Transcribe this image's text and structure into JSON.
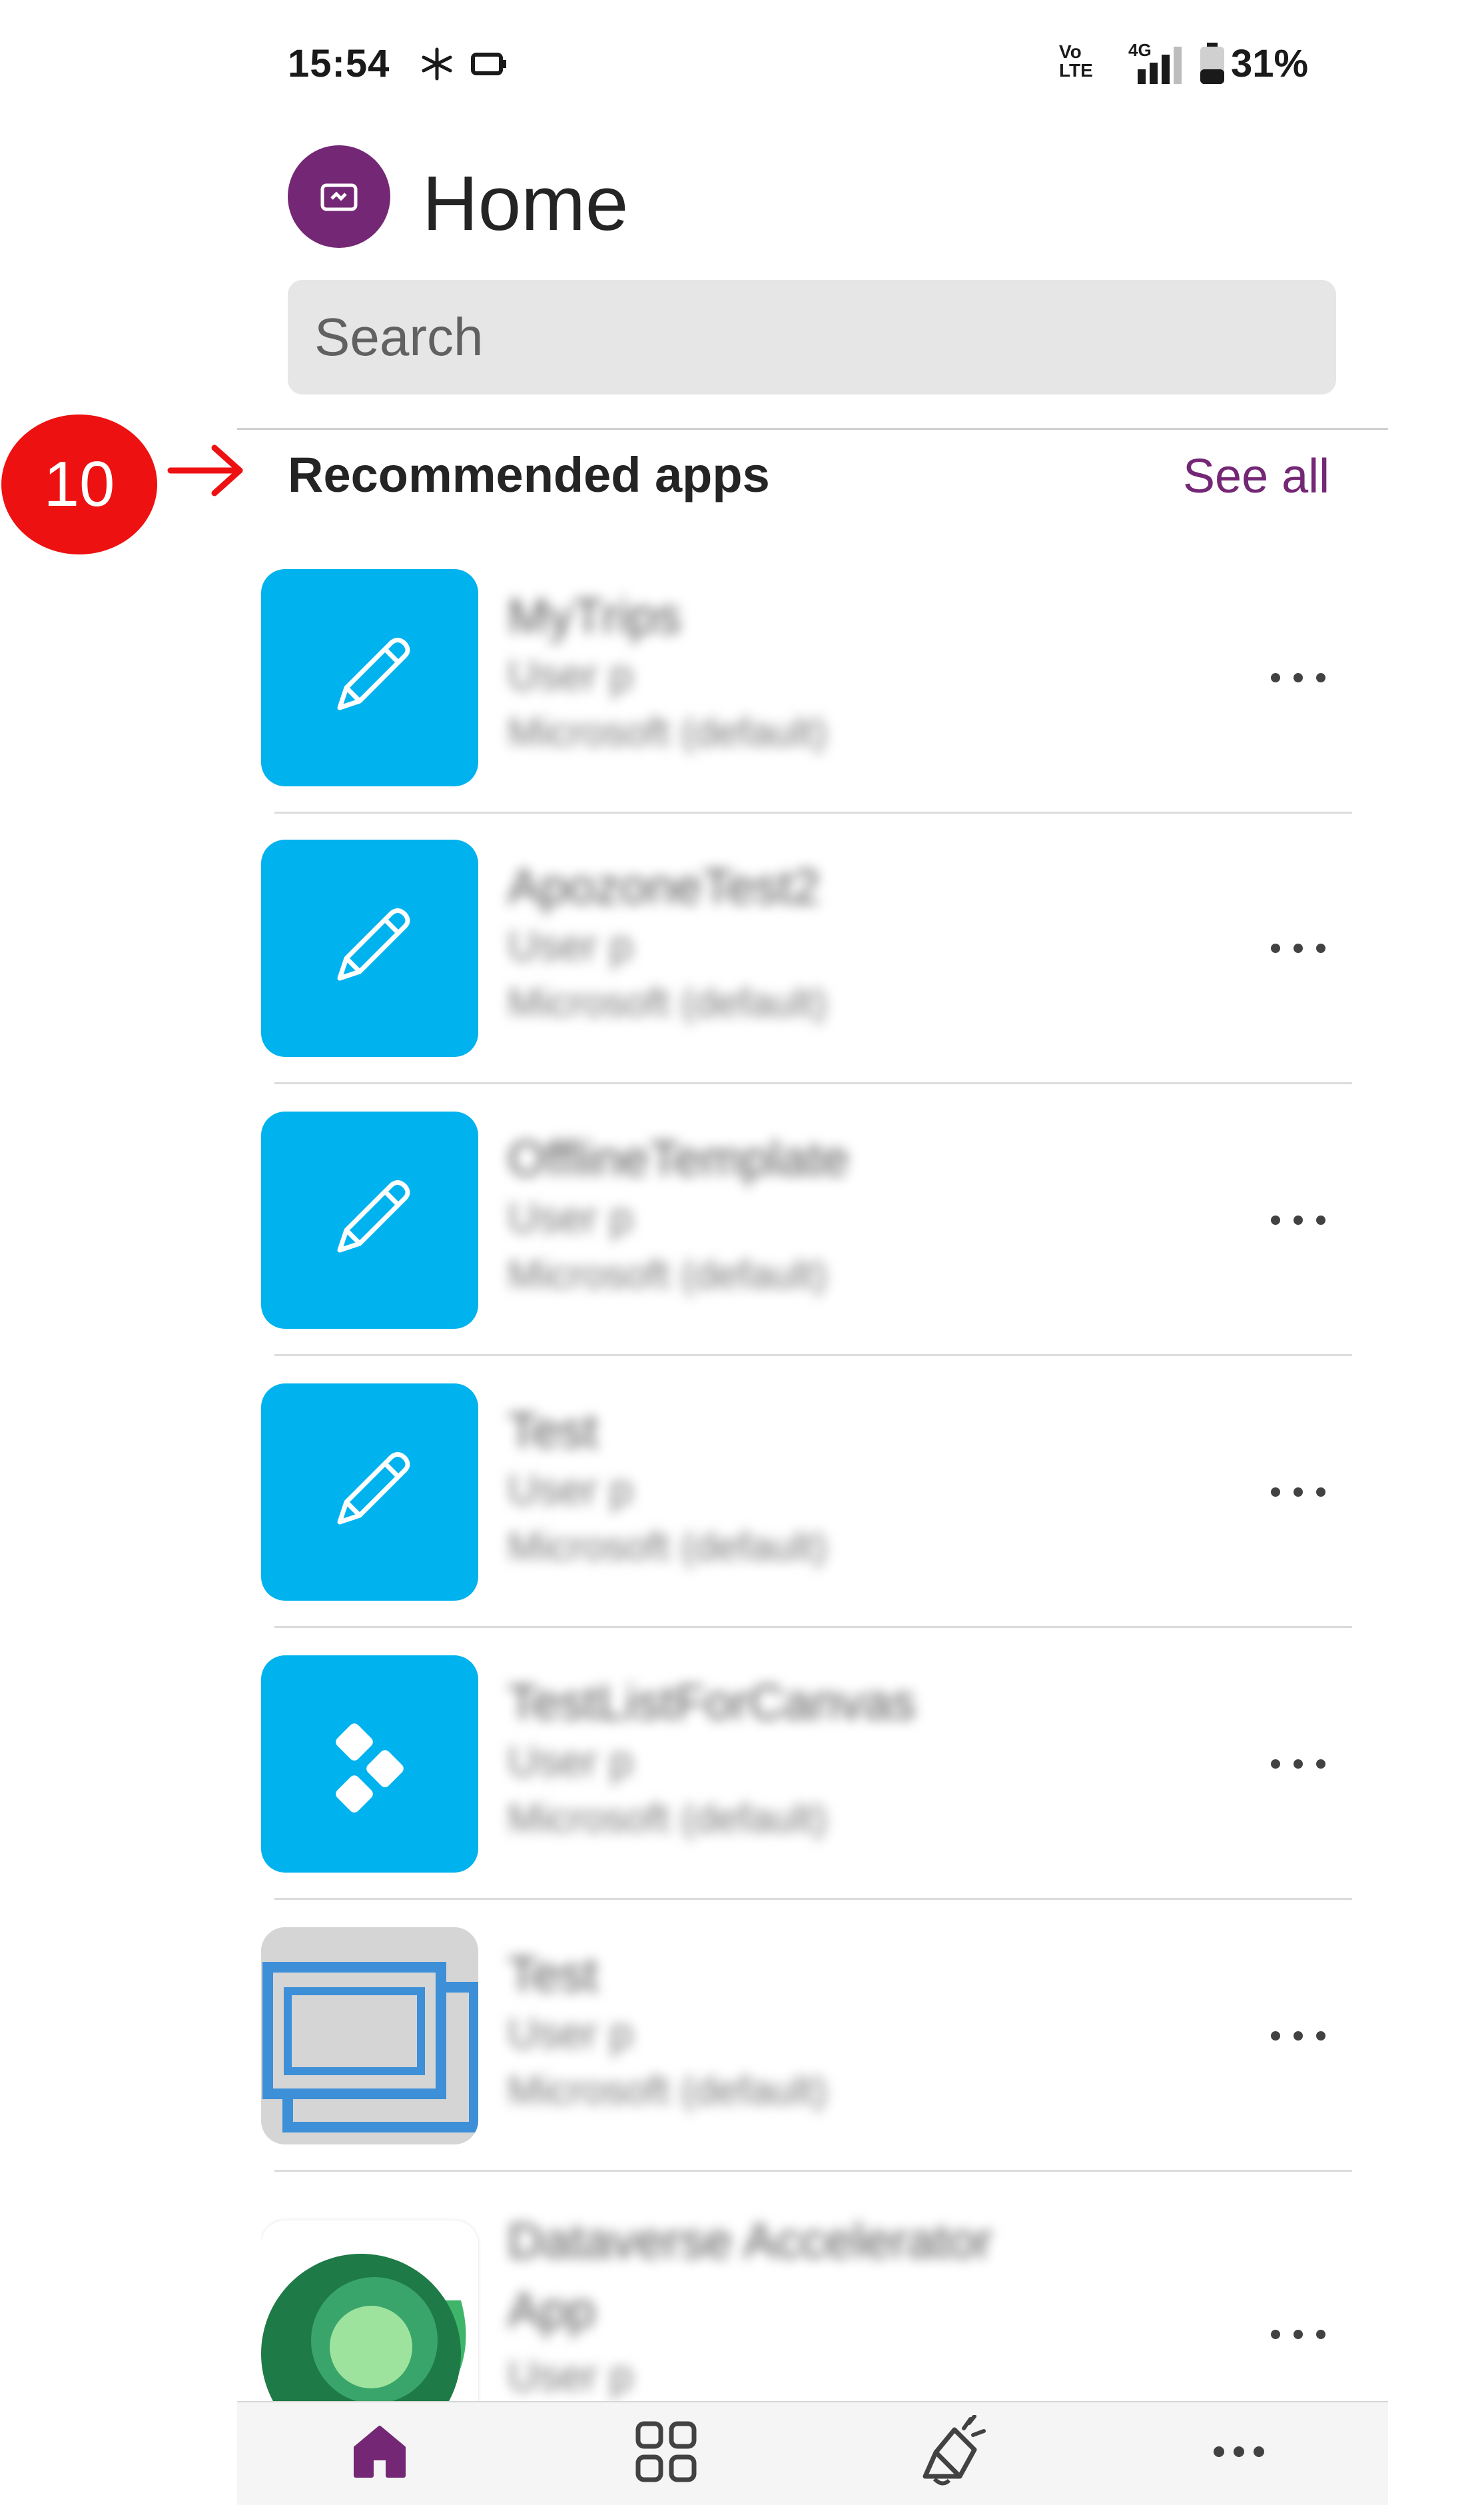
{
  "status_bar": {
    "time": "15:54",
    "network": "4G",
    "volte": "Vo\nLTE",
    "battery": "31%"
  },
  "header": {
    "title": "Home"
  },
  "search": {
    "placeholder": "Search"
  },
  "callout": {
    "number": "10"
  },
  "section": {
    "title": "Recommended apps",
    "see_all": "See all"
  },
  "apps": [
    {
      "name": "MyTrips",
      "owner": "User p",
      "environment": "Microsoft (default)",
      "icon": "pencil-icon"
    },
    {
      "name": "ApozoneTest2",
      "owner": "User p",
      "environment": "Microsoft (default)",
      "icon": "pencil-icon"
    },
    {
      "name": "OfflineTemplate",
      "owner": "User p",
      "environment": "Microsoft (default)",
      "icon": "pencil-icon"
    },
    {
      "name": "Test",
      "owner": "User p",
      "environment": "Microsoft (default)",
      "icon": "pencil-icon"
    },
    {
      "name": "TestListForCanvas",
      "owner": "User p",
      "environment": "Microsoft (default)",
      "icon": "diamonds-icon"
    },
    {
      "name": "Test",
      "owner": "User p",
      "environment": "Microsoft (default)",
      "icon": "windows-icon"
    },
    {
      "name": "Dataverse Accelerator",
      "name_line2": "App",
      "owner": "User p",
      "icon": "dataverse-icon"
    }
  ],
  "nav": [
    {
      "icon": "home-icon",
      "active": true
    },
    {
      "icon": "apps-grid-icon",
      "active": false
    },
    {
      "icon": "megaphone-icon",
      "active": false
    },
    {
      "icon": "more-icon",
      "active": false
    }
  ],
  "colors": {
    "accent": "#742774",
    "tile": "#00b2ee",
    "callout": "#ee1111"
  }
}
